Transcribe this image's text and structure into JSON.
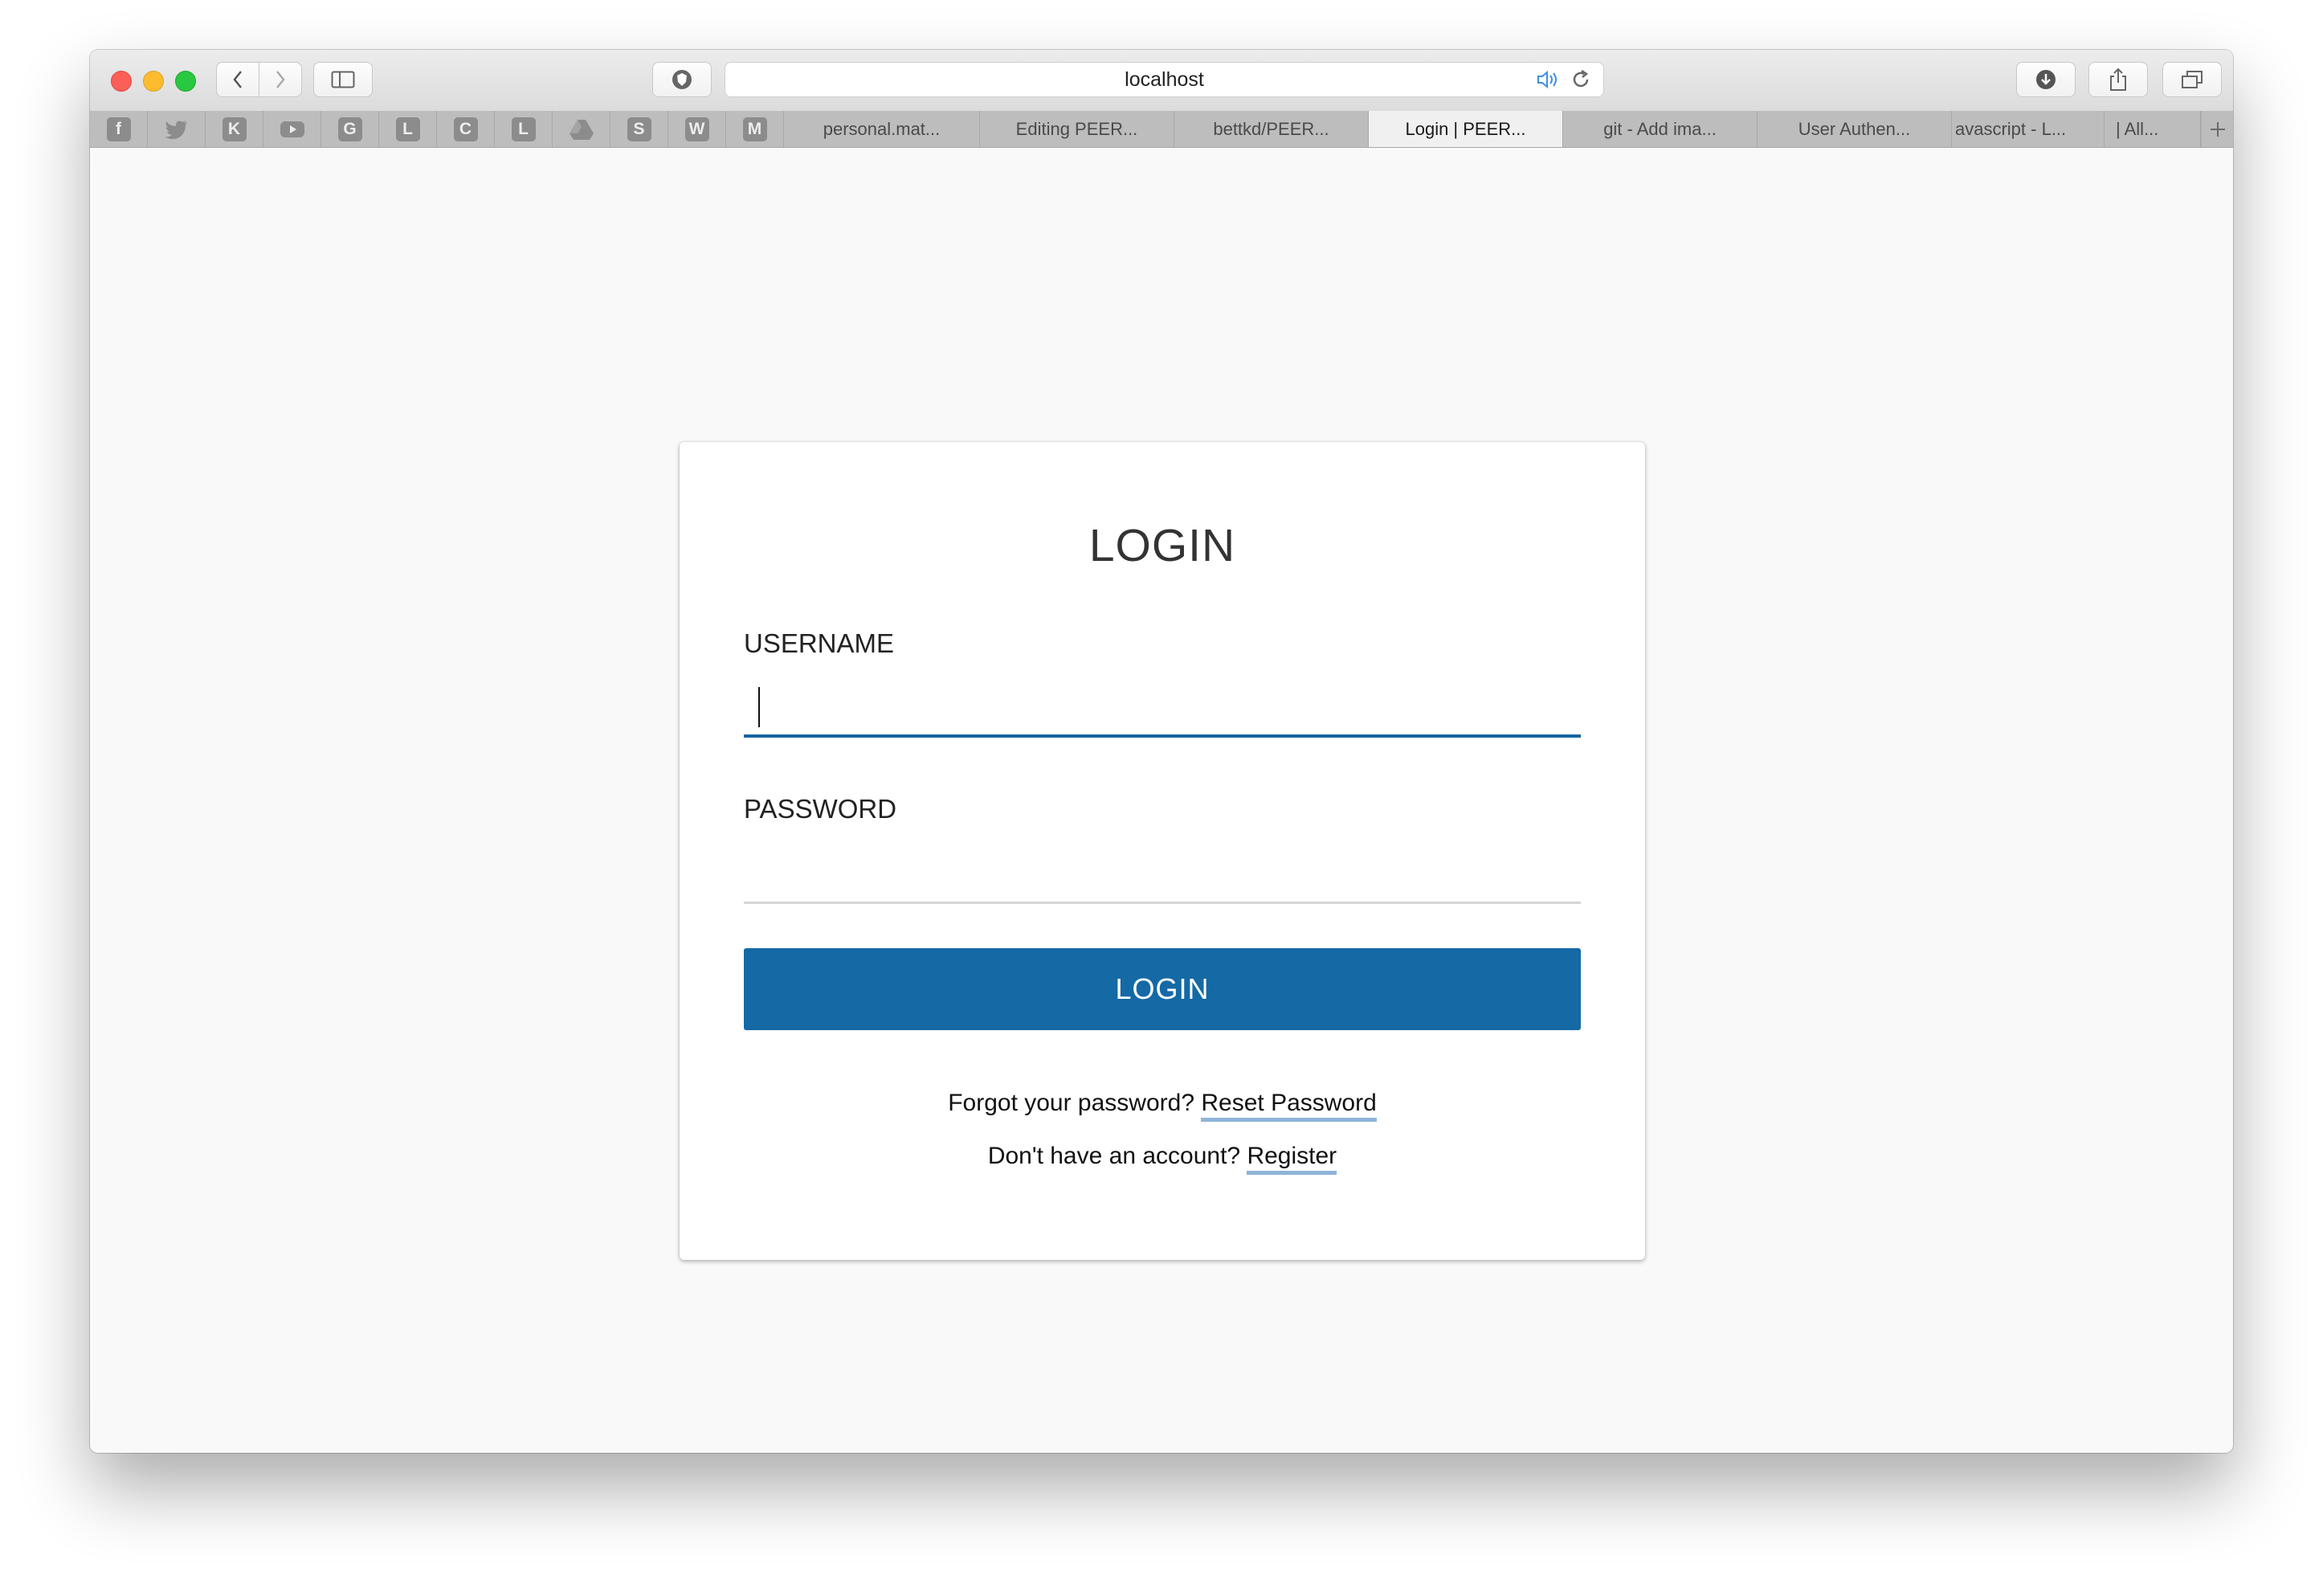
{
  "browser": {
    "address": "localhost",
    "pinned_tabs": [
      {
        "icon": "facebook-icon",
        "glyph": "f"
      },
      {
        "icon": "twitter-icon",
        "glyph": ""
      },
      {
        "icon": "k-site-icon",
        "glyph": "K"
      },
      {
        "icon": "youtube-icon",
        "glyph": ""
      },
      {
        "icon": "g-site-icon",
        "glyph": "G"
      },
      {
        "icon": "l-site-icon",
        "glyph": "L"
      },
      {
        "icon": "c-site-icon",
        "glyph": "C"
      },
      {
        "icon": "l-site-icon-2",
        "glyph": "L"
      },
      {
        "icon": "google-drive-icon",
        "glyph": ""
      },
      {
        "icon": "s-site-icon",
        "glyph": "S"
      },
      {
        "icon": "w-site-icon",
        "glyph": "W"
      },
      {
        "icon": "m-site-icon",
        "glyph": "M"
      }
    ],
    "tabs": [
      {
        "title": "personal.mat..."
      },
      {
        "title": "Editing PEER..."
      },
      {
        "title": "bettkd/PEER..."
      },
      {
        "title": "Login | PEER..."
      },
      {
        "title": "git - Add ima..."
      },
      {
        "title": "User Authen..."
      },
      {
        "title": "avascript - L..."
      },
      {
        "title": "| All..."
      }
    ],
    "active_tab": 3
  },
  "login": {
    "title": "LOGIN",
    "username_label": "USERNAME",
    "username_value": "",
    "password_label": "PASSWORD",
    "password_value": "",
    "submit_label": "LOGIN",
    "forgot_text": "Forgot your password?",
    "reset_link": "Reset Password",
    "no_account_text": "Don't have an account?",
    "register_link": "Register"
  },
  "colors": {
    "primary": "#1569a5",
    "focus_underline": "#1565a3",
    "link_underline": "#8fb4d9"
  }
}
